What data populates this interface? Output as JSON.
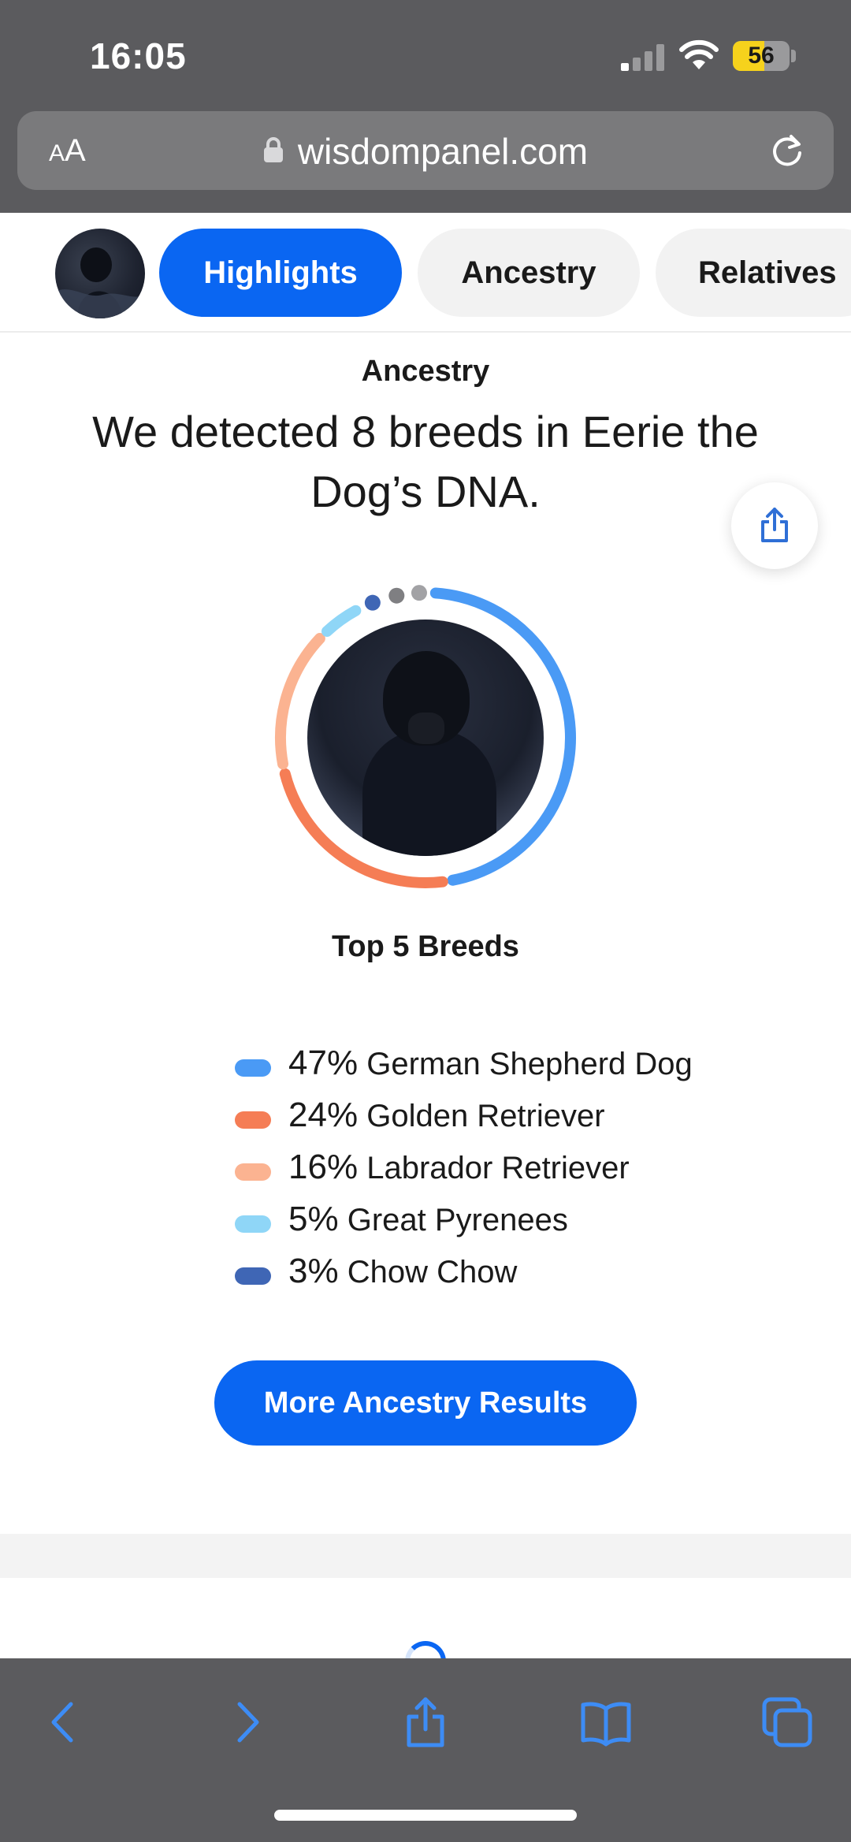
{
  "status_bar": {
    "time": "16:05",
    "battery_level": "56",
    "battery_fraction": 0.56
  },
  "browser": {
    "text_size_button": {
      "small": "A",
      "large": "A"
    },
    "url": "wisdompanel.com"
  },
  "tabs": [
    {
      "label": "Highlights",
      "active": true
    },
    {
      "label": "Ancestry",
      "active": false
    },
    {
      "label": "Relatives",
      "active": false
    }
  ],
  "content": {
    "section_label": "Ancestry",
    "headline": "We detected 8 breeds in Eerie the Dog’s DNA.",
    "top_breeds_title": "Top 5 Breeds",
    "breeds": [
      {
        "percent": "47%",
        "name": "German Shepherd Dog",
        "value": 47,
        "color": "#4a9af5"
      },
      {
        "percent": "24%",
        "name": "Golden Retriever",
        "value": 24,
        "color": "#f57d55"
      },
      {
        "percent": "16%",
        "name": "Labrador Retriever",
        "value": 16,
        "color": "#fbb391"
      },
      {
        "percent": "5%",
        "name": "Great Pyrenees",
        "value": 5,
        "color": "#8fd6f7"
      },
      {
        "percent": "3%",
        "name": "Chow Chow",
        "value": 3,
        "color": "#3f66b5"
      }
    ],
    "other_breed_segments": [
      {
        "value": 2.5,
        "color": "#7f7f82"
      },
      {
        "value": 2.5,
        "color": "#a2a2a5"
      }
    ],
    "more_button": "More Ancestry Results"
  },
  "colors": {
    "accent": "#0a66f2",
    "chrome": "#5b5b5e",
    "toolbar_icon": "#3d8cf5"
  },
  "toolbar": {
    "icons": [
      "back-icon",
      "forward-icon",
      "share-icon",
      "bookmarks-icon",
      "tabs-icon"
    ]
  }
}
